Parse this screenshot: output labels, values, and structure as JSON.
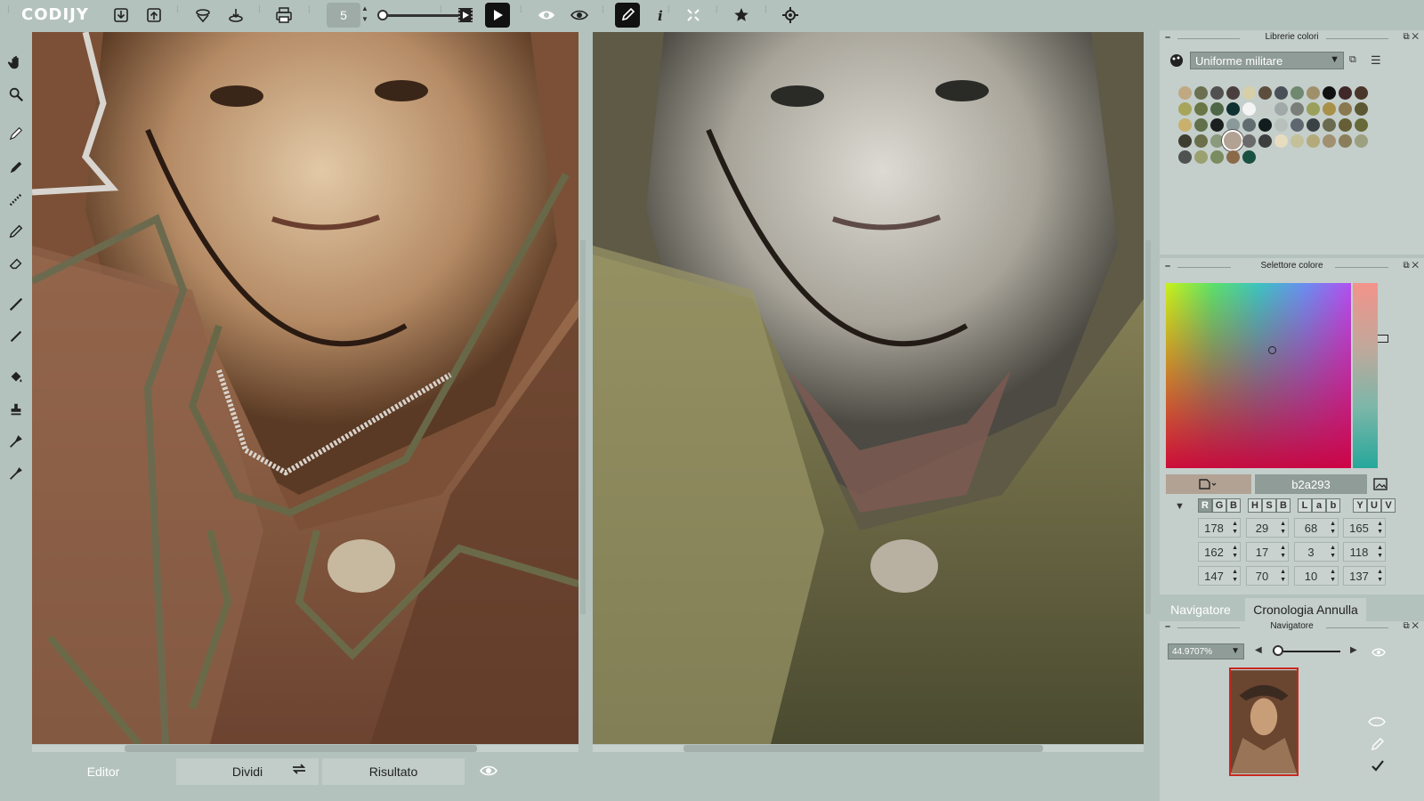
{
  "app": {
    "logo": "CODIJY"
  },
  "toolbar": {
    "brush_size": "5",
    "icons": [
      "import-icon",
      "export-icon",
      "recolor-icon",
      "save-icon",
      "print-icon",
      "filmstrip-icon",
      "play-icon",
      "eye-icon",
      "view-toggle-icon",
      "pencil-mode-icon",
      "info-icon",
      "fit-icon",
      "effects-icon",
      "settings-icon"
    ]
  },
  "tabs": {
    "editor": "Editor",
    "dividi": "Dividi",
    "risultato": "Risultato"
  },
  "color_libraries": {
    "title": "Librerie colori",
    "selected_library": "Uniforme militare",
    "swatches": [
      [
        "#c0a882",
        "#6a7050",
        "#505050",
        "#4a3e3e",
        "#d6cfa8",
        "#5c4d3c",
        "#4a5058",
        "#6f8870",
        "#a0906a",
        "#111111",
        "#402828",
        "#4a3628"
      ],
      [
        "#a7a55a",
        "#6a7545",
        "#4e6847",
        "#0e3030",
        "#f4f4f4",
        "#c6ccc8",
        "#a0a8a8",
        "#7a7e78",
        "#9aa05a",
        "#a89048",
        "#8a7850",
        "#5c5834"
      ],
      [
        "#c9b06d",
        "#61704a",
        "#1b201e",
        "#8a9a9a",
        "#606c70",
        "#111c1c",
        "#b8c0bc",
        "#5e6670",
        "#3a4246",
        "#6a6a50",
        "#665e36",
        "#676a38"
      ],
      [
        "#3d3d30",
        "#6b6f4a",
        "#8a9a7a",
        "#b2a293",
        "#6a6a6a",
        "#3d3e3e",
        "#e8dcc0",
        "#c4c09a",
        "#b2aa7a",
        "#a09070",
        "#8a7e5a",
        "#9ca080"
      ],
      [
        "#4e5250",
        "#9aa070",
        "#7a8c60",
        "#8a6a48",
        "#1a5040"
      ]
    ]
  },
  "color_picker": {
    "title": "Selettore colore",
    "hex": "b2a293",
    "modes": {
      "rgb": [
        "R",
        "G",
        "B"
      ],
      "hsb": [
        "H",
        "S",
        "B"
      ],
      "lab": [
        "L",
        "a",
        "b"
      ],
      "yuv": [
        "Y",
        "U",
        "V"
      ]
    },
    "rows": [
      [
        "178",
        "29",
        "68",
        "165"
      ],
      [
        "162",
        "17",
        "3",
        "118"
      ],
      [
        "147",
        "70",
        "10",
        "137"
      ]
    ]
  },
  "navigator": {
    "tab_navigator": "Navigatore",
    "tab_history": "Cronologia Annulla",
    "title": "Navigatore",
    "zoom": "44.9707%"
  }
}
